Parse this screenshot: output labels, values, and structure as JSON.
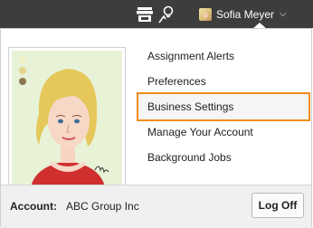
{
  "topbar": {
    "icons": [
      "store-icon",
      "lightbulb-chat-icon"
    ],
    "user_name": "Sofia Meyer",
    "chevron": "⌵"
  },
  "menu": {
    "items": [
      {
        "label": "Assignment Alerts",
        "highlighted": false
      },
      {
        "label": "Preferences",
        "highlighted": false
      },
      {
        "label": "Business Settings",
        "highlighted": true
      },
      {
        "label": "Manage Your Account",
        "highlighted": false
      },
      {
        "label": "Background Jobs",
        "highlighted": false
      }
    ]
  },
  "footer": {
    "account_label": "Account:",
    "account_value": "ABC Group Inc",
    "logoff_label": "Log Off"
  },
  "colors": {
    "topbar": "#3d3d3d",
    "highlight_border": "#f08c1a",
    "avatar_bg": "#e7f2d6"
  }
}
